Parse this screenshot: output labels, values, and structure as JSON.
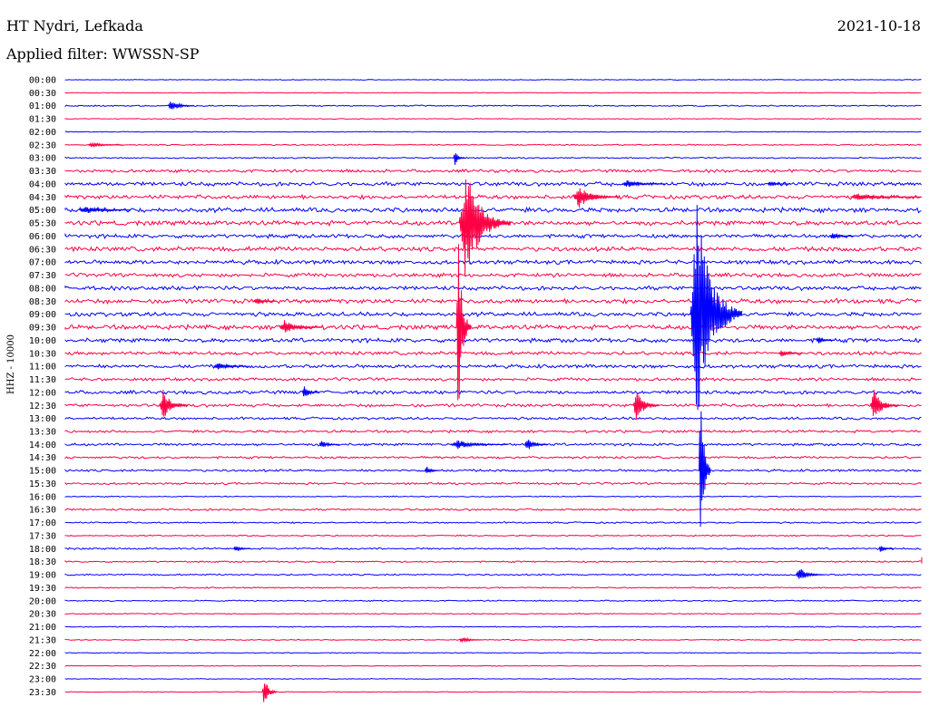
{
  "header": {
    "station": "HT Nydri, Lefkada",
    "date": "2021-10-18",
    "filter": "Applied filter: WWSSN-SP"
  },
  "colors": {
    "odd_trace": "#0000ff",
    "even_trace": "#ff0044",
    "text": "#000000"
  },
  "chart_data": {
    "type": "line",
    "ylabel": "HHZ - 10000",
    "time_labels": [
      "00:00",
      "00:30",
      "01:00",
      "01:30",
      "02:00",
      "02:30",
      "03:00",
      "03:30",
      "04:00",
      "04:30",
      "05:00",
      "05:30",
      "06:00",
      "06:30",
      "07:00",
      "07:30",
      "08:00",
      "08:30",
      "09:00",
      "09:30",
      "10:00",
      "10:30",
      "11:00",
      "11:30",
      "12:00",
      "12:30",
      "13:00",
      "13:30",
      "14:00",
      "14:30",
      "15:00",
      "15:30",
      "16:00",
      "16:30",
      "17:00",
      "17:30",
      "18:00",
      "18:30",
      "19:00",
      "19:30",
      "20:00",
      "20:30",
      "21:00",
      "21:30",
      "22:00",
      "22:30",
      "23:00",
      "23:30"
    ],
    "trace_minutes": 30,
    "row_noise": [
      0.3,
      0.3,
      0.5,
      0.3,
      0.3,
      0.5,
      0.5,
      1.2,
      1.6,
      1.6,
      1.8,
      1.8,
      1.5,
      1.8,
      1.6,
      1.5,
      1.6,
      1.8,
      1.6,
      1.8,
      1.6,
      1.4,
      1.4,
      1.2,
      1.4,
      1.2,
      1.0,
      1.0,
      1.0,
      0.9,
      0.9,
      0.8,
      0.4,
      0.8,
      0.6,
      0.5,
      0.7,
      0.6,
      0.6,
      0.5,
      0.5,
      0.4,
      0.4,
      0.4,
      0.3,
      0.3,
      0.3,
      0.3
    ],
    "events": [
      {
        "row": 2,
        "minute": 3.6,
        "amplitude": 7,
        "duration": 0.9
      },
      {
        "row": 5,
        "minute": 0.8,
        "amplitude": 3,
        "duration": 1.2
      },
      {
        "row": 6,
        "minute": 13.6,
        "amplitude": 8,
        "duration": 0.4
      },
      {
        "row": 8,
        "minute": 19.5,
        "amplitude": 4,
        "duration": 1.5
      },
      {
        "row": 8,
        "minute": 24.6,
        "amplitude": 3,
        "duration": 0.8
      },
      {
        "row": 9,
        "minute": 17.8,
        "amplitude": 12,
        "duration": 1.6
      },
      {
        "row": 9,
        "minute": 27.5,
        "amplitude": 4,
        "duration": 3.0
      },
      {
        "row": 10,
        "minute": 0.5,
        "amplitude": 4,
        "duration": 1.8
      },
      {
        "row": 11,
        "minute": 13.8,
        "amplitude": 65,
        "duration": 1.8
      },
      {
        "row": 12,
        "minute": 26.8,
        "amplitude": 4,
        "duration": 0.8
      },
      {
        "row": 17,
        "minute": 6.6,
        "amplitude": 4,
        "duration": 0.8
      },
      {
        "row": 18,
        "minute": 21.9,
        "amplitude": 130,
        "duration": 1.8
      },
      {
        "row": 19,
        "minute": 7.5,
        "amplitude": 8,
        "duration": 1.5
      },
      {
        "row": 19,
        "minute": 13.7,
        "amplitude": 110,
        "duration": 0.5
      },
      {
        "row": 20,
        "minute": 26.3,
        "amplitude": 5,
        "duration": 0.6
      },
      {
        "row": 21,
        "minute": 25.0,
        "amplitude": 4,
        "duration": 0.8
      },
      {
        "row": 22,
        "minute": 5.2,
        "amplitude": 4,
        "duration": 1.2
      },
      {
        "row": 24,
        "minute": 8.3,
        "amplitude": 7,
        "duration": 0.6
      },
      {
        "row": 25,
        "minute": 3.3,
        "amplitude": 18,
        "duration": 1.0
      },
      {
        "row": 25,
        "minute": 19.9,
        "amplitude": 18,
        "duration": 0.9
      },
      {
        "row": 25,
        "minute": 28.2,
        "amplitude": 18,
        "duration": 1.0
      },
      {
        "row": 28,
        "minute": 8.9,
        "amplitude": 5,
        "duration": 0.7
      },
      {
        "row": 28,
        "minute": 13.5,
        "amplitude": 5,
        "duration": 2.0
      },
      {
        "row": 28,
        "minute": 16.1,
        "amplitude": 7,
        "duration": 0.8
      },
      {
        "row": 30,
        "minute": 12.6,
        "amplitude": 5,
        "duration": 0.5
      },
      {
        "row": 30,
        "minute": 22.2,
        "amplitude": 110,
        "duration": 0.4
      },
      {
        "row": 36,
        "minute": 5.9,
        "amplitude": 4,
        "duration": 0.6
      },
      {
        "row": 36,
        "minute": 28.5,
        "amplitude": 4,
        "duration": 0.5
      },
      {
        "row": 37,
        "minute": 30.0,
        "amplitude": 6,
        "duration": 0.3
      },
      {
        "row": 38,
        "minute": 25.6,
        "amplitude": 8,
        "duration": 1.0
      },
      {
        "row": 43,
        "minute": 13.8,
        "amplitude": 4,
        "duration": 0.8
      },
      {
        "row": 47,
        "minute": 6.9,
        "amplitude": 22,
        "duration": 0.5
      }
    ]
  }
}
